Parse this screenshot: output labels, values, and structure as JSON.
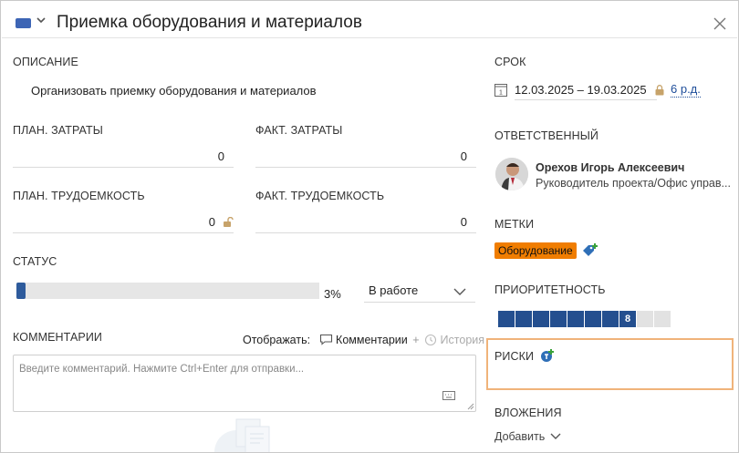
{
  "header": {
    "title": "Приемка оборудования и материалов",
    "type_color": "#3d65b5"
  },
  "description": {
    "label": "ОПИСАНИЕ",
    "text": "Организовать приемку оборудования и материалов"
  },
  "costs": {
    "plan_label": "ПЛАН. ЗАТРАТЫ",
    "plan_value": "0",
    "fact_label": "ФАКТ. ЗАТРАТЫ",
    "fact_value": "0"
  },
  "effort": {
    "plan_label": "ПЛАН. ТРУДОЕМКОСТЬ",
    "plan_value": "0",
    "fact_label": "ФАКТ. ТРУДОЕМКОСТЬ",
    "fact_value": "0"
  },
  "status": {
    "label": "СТАТУС",
    "progress_percent": 3,
    "progress_text": "3%",
    "selected": "В работе",
    "progress_color": "#2e5b9c"
  },
  "comments": {
    "label": "КОММЕНТАРИИ",
    "show_label": "Отображать:",
    "comments_option": "Комментарии",
    "plus": "+",
    "history_option": "История",
    "placeholder": "Введите комментарий. Нажмите Ctrl+Enter для отправки..."
  },
  "deadline": {
    "label": "СРОК",
    "range": "12.03.2025 – 19.03.2025",
    "duration": "6 р.д."
  },
  "responsible": {
    "label": "ОТВЕТСТВЕННЫЙ",
    "name": "Орехов Игорь Алексеевич",
    "role": "Руководитель проекта/Офис управ..."
  },
  "tags": {
    "label": "МЕТКИ",
    "items": [
      "Оборудование"
    ],
    "tag_color": "#f07d00"
  },
  "priority": {
    "label": "ПРИОРИТЕТНОСТЬ",
    "value": 8,
    "max": 10,
    "label_text": "8",
    "color": "#244f8f"
  },
  "risks": {
    "label": "РИСКИ",
    "highlight_color": "#f0b37a"
  },
  "attachments": {
    "label": "ВЛОЖЕНИЯ",
    "add_label": "Добавить"
  }
}
